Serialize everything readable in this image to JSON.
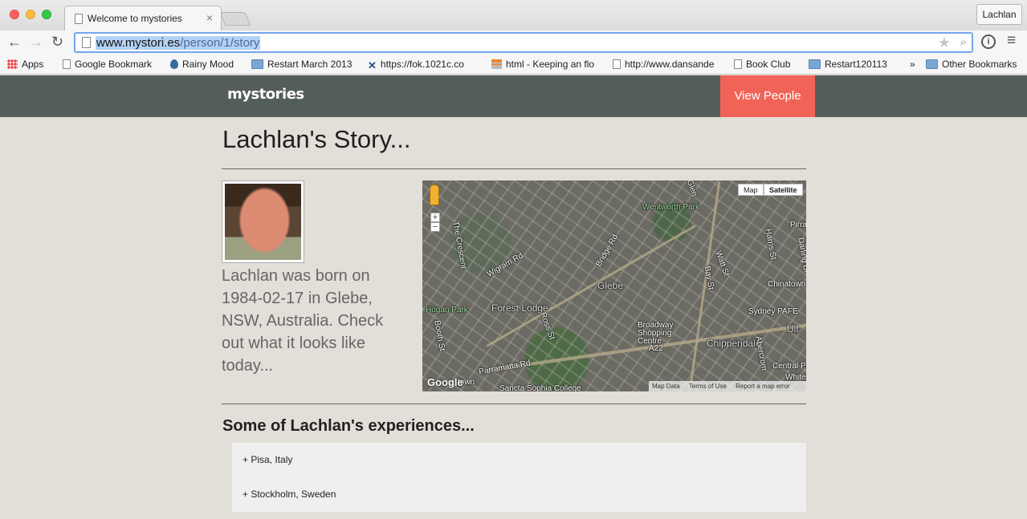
{
  "browser": {
    "tab_title": "Welcome to mystories",
    "tab_close": "×",
    "profile_name": "Lachlan",
    "url_domain": "www.mystori.es",
    "url_path": "/person/1/story",
    "bookmarks": [
      {
        "label": "Apps",
        "icon": "apps-icon"
      },
      {
        "label": "Google Bookmark",
        "icon": "page-icon"
      },
      {
        "label": "Rainy Mood",
        "icon": "raindrop-icon"
      },
      {
        "label": "Restart March 2013",
        "icon": "folder-icon"
      },
      {
        "label": "https://fok.1021c.co",
        "icon": "x-icon"
      },
      {
        "label": "html - Keeping an flo",
        "icon": "stackoverflow-icon"
      },
      {
        "label": "http://www.dansande",
        "icon": "page-icon"
      },
      {
        "label": "Book Club",
        "icon": "page-icon"
      },
      {
        "label": "Restart120113",
        "icon": "folder-icon"
      }
    ],
    "bookmarks_overflow": "»",
    "other_bookmarks": "Other Bookmarks"
  },
  "site": {
    "logo": "mystories",
    "nav_button": "View People",
    "accent_color": "#f26357",
    "nav_color": "#535d59"
  },
  "story": {
    "title": "Lachlan's Story...",
    "bio": "Lachlan was born on 1984-02-17 in Glebe, NSW, Australia. Check out what it looks like today..."
  },
  "map": {
    "type_buttons": [
      "Map",
      "Satellite"
    ],
    "zoom_in": "+",
    "zoom_out": "−",
    "labels": {
      "glebe": "Glebe",
      "forest_lodge": "Forest Lodge",
      "chippendale": "Chippendale",
      "wentworth_park": "Wentworth Park",
      "hogan_park": "Hogan Park",
      "parramatta_rd": "Parramatta Rd",
      "wigram_rd": "Wigram Rd",
      "bridge_rd": "Bridge Rd",
      "the_crescent": "The Crescent",
      "broadway": "Broadway Shopping Centre",
      "chinatown": "Chinatown",
      "sydney_pafe": "Sydney PAFE",
      "central_park": "Central Park",
      "a22": "A22",
      "sancta_sophia": "Sancta Sophia College",
      "watt_st": "Watt St",
      "bay_st": "Bay St",
      "harris_st": "Harris St",
      "ross_st": "Ross St",
      "booth_st": "Booth St",
      "darling_dr": "Darling Dr",
      "abercrombie": "Abercrom",
      "pirrama": "Pirra",
      "white": "White",
      "ult": "Ult",
      "glen": "Glen",
      "town": "town"
    },
    "google_logo": "Google",
    "footer": [
      "Map Data",
      "Terms of Use",
      "Report a map error"
    ]
  },
  "experiences": {
    "heading": "Some of Lachlan's experiences...",
    "items": [
      "+ Pisa, Italy",
      "+ Stockholm, Sweden"
    ]
  }
}
